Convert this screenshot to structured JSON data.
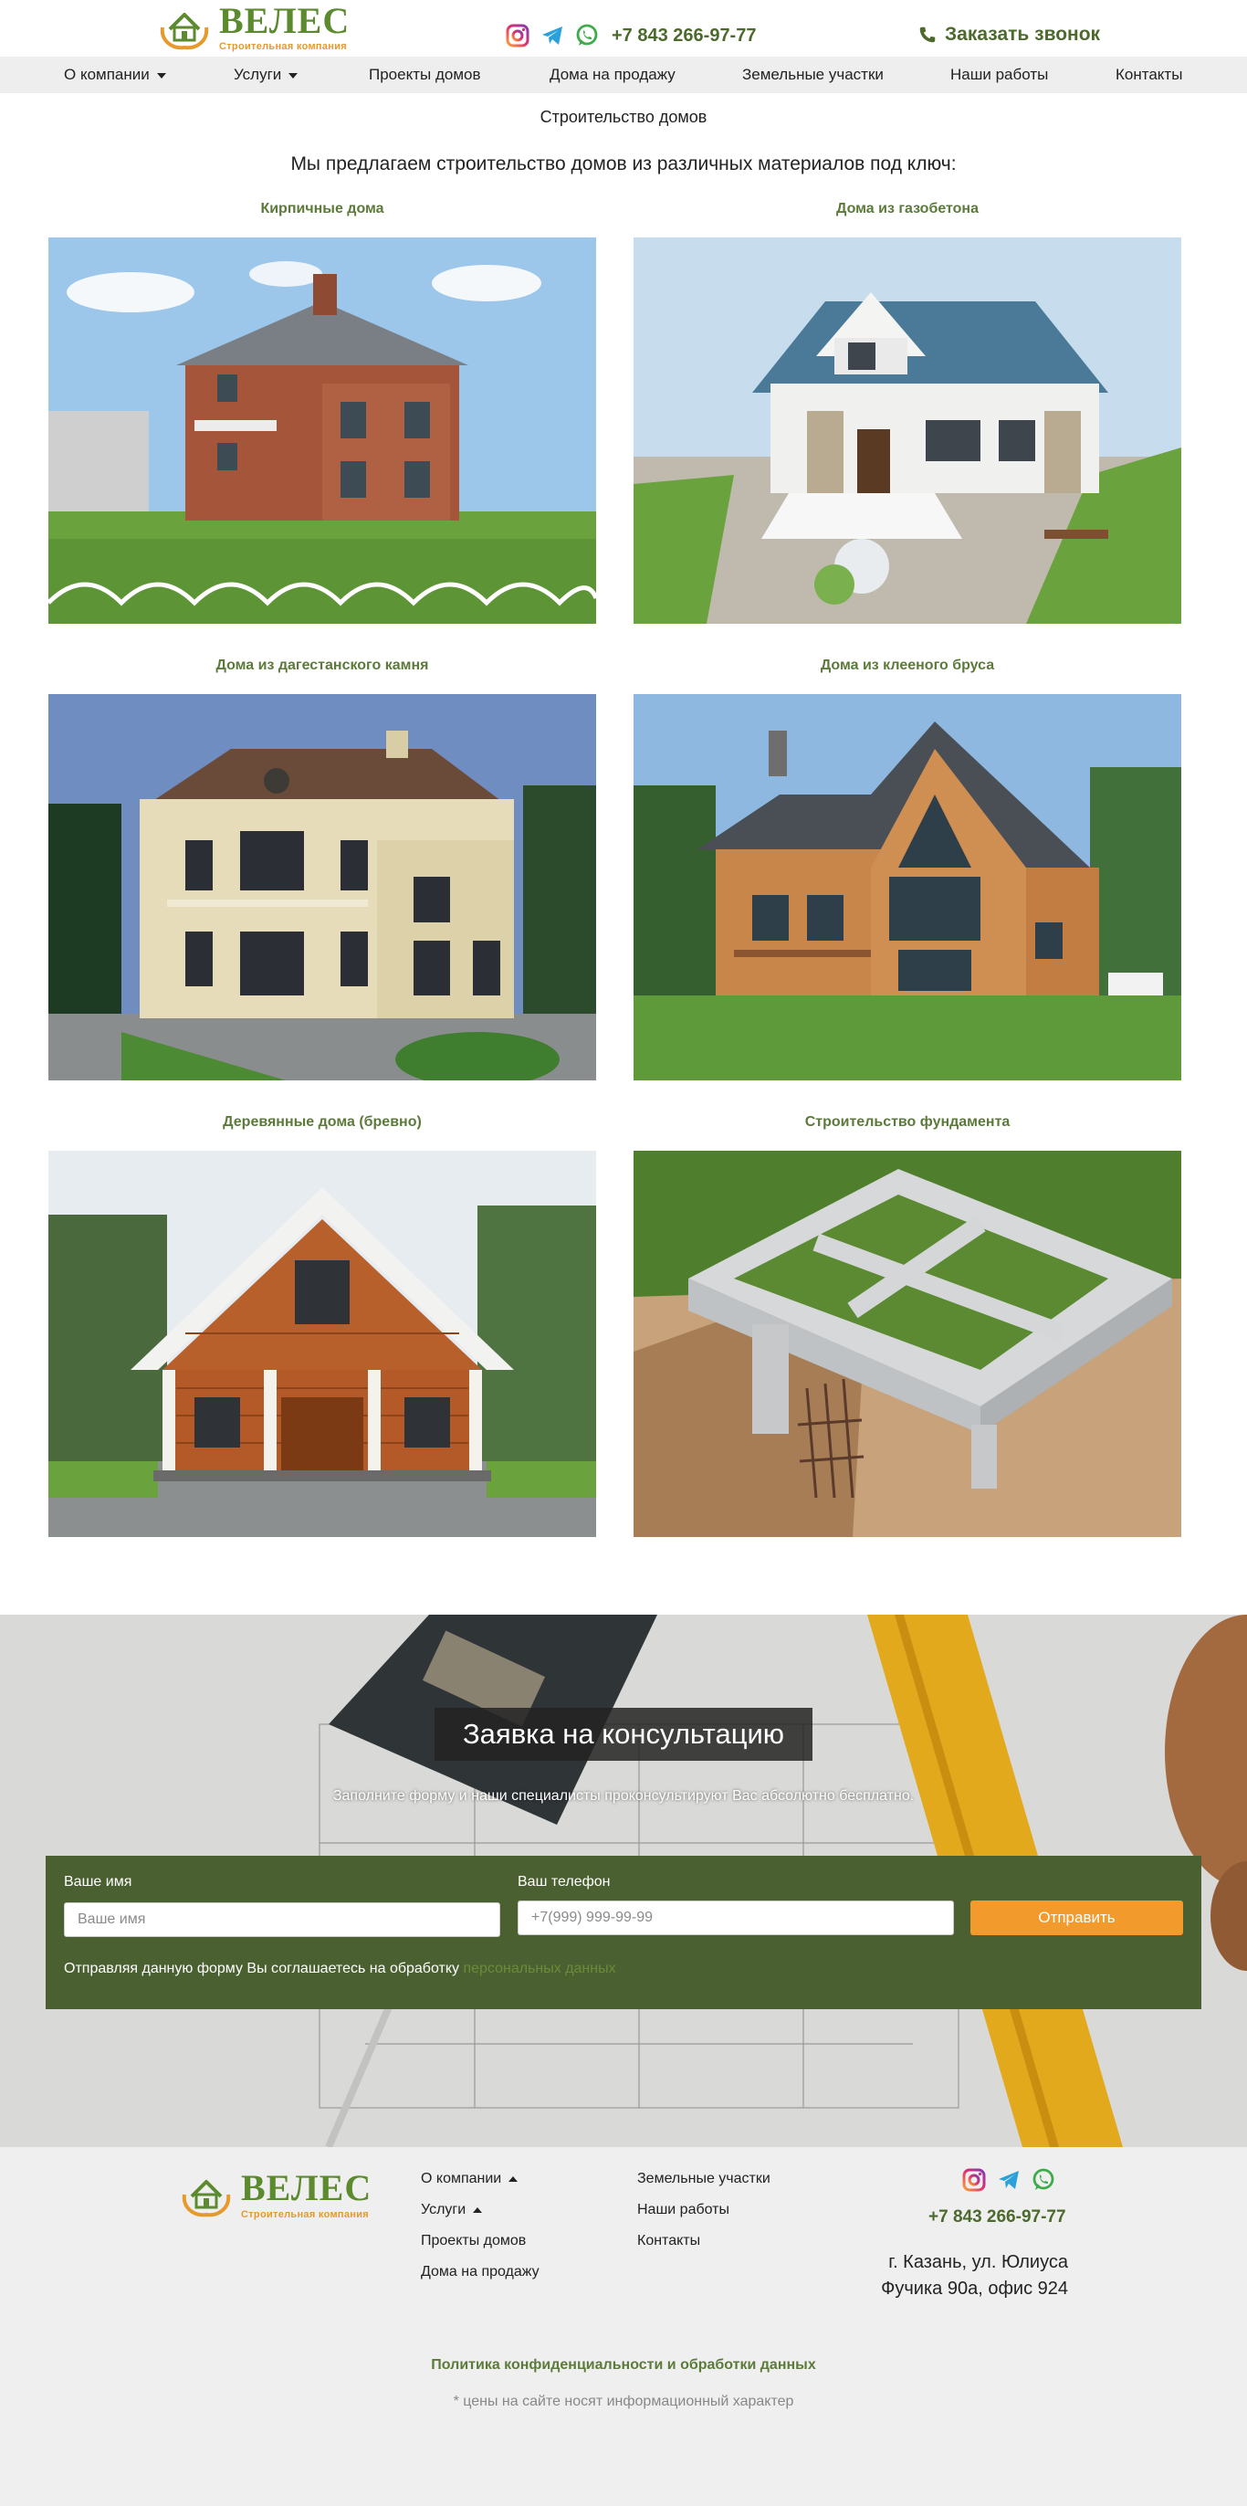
{
  "brand": {
    "name": "ВЕЛЕС",
    "tagline": "Строительная компания"
  },
  "header": {
    "phone": "+7 843 266-97-77",
    "callback_label": "Заказать звонок",
    "socials": [
      "instagram-icon",
      "telegram-icon",
      "whatsapp-icon"
    ]
  },
  "nav": {
    "items": [
      {
        "label": "О компании",
        "dropdown": true
      },
      {
        "label": "Услуги",
        "dropdown": true
      },
      {
        "label": "Проекты домов"
      },
      {
        "label": "Дома на продажу"
      },
      {
        "label": "Земельные участки"
      },
      {
        "label": "Наши работы"
      },
      {
        "label": "Контакты"
      }
    ]
  },
  "main": {
    "title": "Строительство домов",
    "intro": "Мы предлагаем строительство домов из различных материалов под ключ:",
    "cards": [
      {
        "title": "Кирпичные дома"
      },
      {
        "title": "Дома из газобетона"
      },
      {
        "title": "Дома из дагестанского камня"
      },
      {
        "title": "Дома из клееного бруса"
      },
      {
        "title": "Деревянные дома (бревно)"
      },
      {
        "title": "Строительство фундамента"
      }
    ]
  },
  "consult": {
    "title": "Заявка на консультацию",
    "subtitle": "Заполните форму и наши специалисты проконсультируют Вас абсолютно бесплатно.",
    "name_label": "Ваше имя",
    "name_placeholder": "Ваше имя",
    "phone_label": "Ваш телефон",
    "phone_placeholder": "+7(999) 999-99-99",
    "submit_label": "Отправить",
    "consent_text": "Отправляя данную форму Вы соглашаетесь на обработку",
    "consent_link": "персональных данных"
  },
  "footer": {
    "col1": [
      {
        "label": "О компании",
        "dropdown": true
      },
      {
        "label": "Услуги",
        "dropdown": true
      },
      {
        "label": "Проекты домов"
      },
      {
        "label": "Дома на продажу"
      }
    ],
    "col2": [
      {
        "label": "Земельные участки"
      },
      {
        "label": "Наши работы"
      },
      {
        "label": "Контакты"
      }
    ],
    "phone": "+7 843 266-97-77",
    "address_line1": "г. Казань, ул. Юлиуса",
    "address_line2": "Фучика 90а, офис 924",
    "policy": "Политика конфиденциальности и обработки данных",
    "disclaimer": "* цены на сайте носят информационный характер"
  },
  "colors": {
    "brand_green": "#5c8a2f",
    "brand_orange": "#e69a2c",
    "form_bg": "#4b6030",
    "button": "#f39a2c"
  }
}
